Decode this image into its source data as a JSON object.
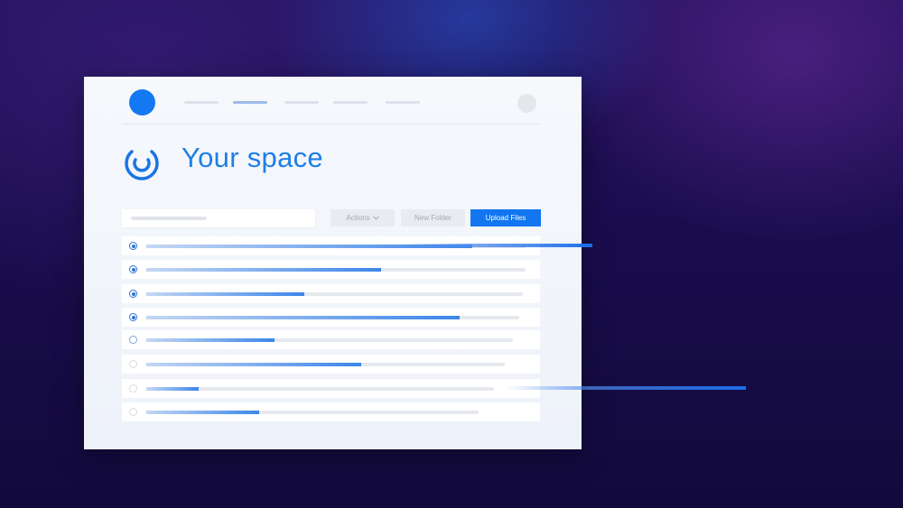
{
  "page": {
    "title": "Your space"
  },
  "header": {
    "logo_icon": "blue-dot-logo",
    "avatar_icon": "user-avatar-placeholder",
    "nav_active_index": 1
  },
  "title_icon": "space-ring-icon",
  "search": {
    "placeholder": ""
  },
  "toolbar": {
    "actions_label": "Actions",
    "actions_icon": "chevron-down-icon",
    "new_folder_label": "New Folder",
    "upload_label": "Upload Files"
  },
  "files": [
    {
      "selected": true,
      "progress": 0.86
    },
    {
      "selected": true,
      "progress": 0.62
    },
    {
      "selected": true,
      "progress": 0.42
    },
    {
      "selected": true,
      "progress": 0.84
    },
    {
      "selected": false,
      "progress": 0.35
    },
    {
      "selected": false,
      "progress": 0.6
    },
    {
      "selected": false,
      "progress": 0.15
    },
    {
      "selected": false,
      "progress": 0.34
    }
  ],
  "colors": {
    "accent": "#1176f0",
    "title": "#1d7fe6",
    "background_dark": "#1a0d4e"
  }
}
